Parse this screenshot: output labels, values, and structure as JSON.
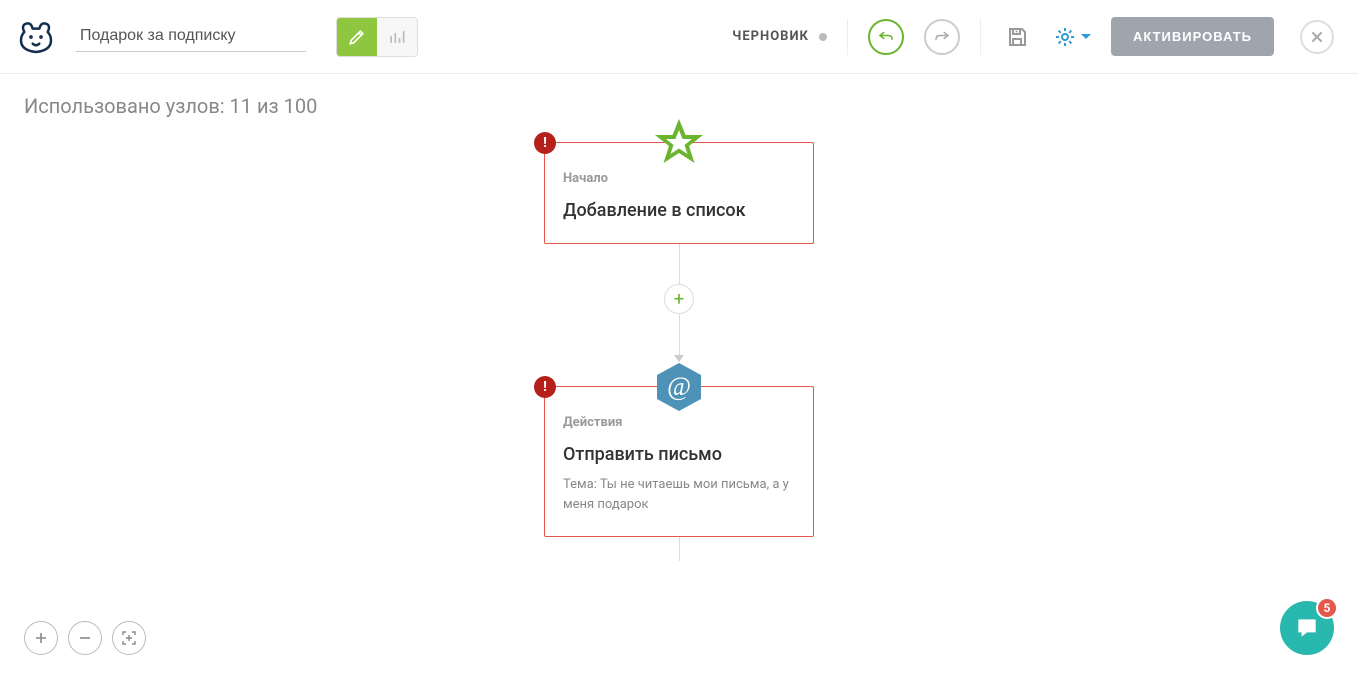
{
  "header": {
    "title": "Подарок за подписку",
    "status_label": "ЧЕРНОВИК",
    "activate_label": "АКТИВИРОВАТЬ"
  },
  "canvas": {
    "nodes_used": "Использовано узлов: 11 из 100"
  },
  "nodes": {
    "start": {
      "section": "Начало",
      "title": "Добавление в список",
      "error": "!"
    },
    "action": {
      "section": "Действия",
      "title": "Отправить письмо",
      "subtitle": "Тема: Ты не читаешь мои письма, а у меня подарок",
      "error": "!"
    }
  },
  "icons": {
    "plus": "+",
    "close": "×",
    "error": "!"
  },
  "chat": {
    "badge": "5"
  }
}
